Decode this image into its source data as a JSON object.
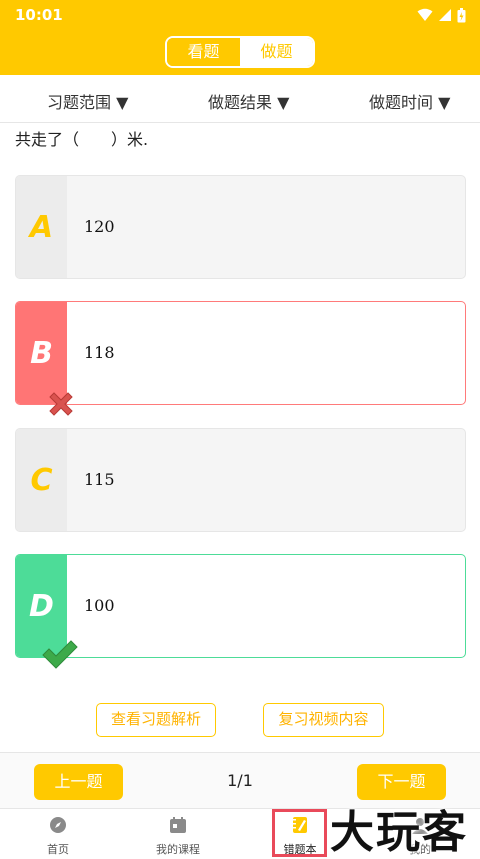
{
  "status": {
    "time": "10:01"
  },
  "header": {
    "tabs": [
      {
        "label": "看题",
        "active": false
      },
      {
        "label": "做题",
        "active": true
      }
    ]
  },
  "filters": [
    "习题范围",
    "做题结果",
    "做题时间"
  ],
  "question": {
    "text": "共走了（　　）米."
  },
  "options": [
    {
      "letter": "A",
      "value": "120",
      "state": "normal"
    },
    {
      "letter": "B",
      "value": "118",
      "state": "wrong"
    },
    {
      "letter": "C",
      "value": "115",
      "state": "normal"
    },
    {
      "letter": "D",
      "value": "100",
      "state": "correct"
    }
  ],
  "actions": {
    "analysis": "查看习题解析",
    "review_video": "复习视频内容"
  },
  "pager": {
    "prev": "上一题",
    "next": "下一题",
    "count": "1/1"
  },
  "nav": [
    {
      "label": "首页",
      "icon": "compass-icon"
    },
    {
      "label": "我的课程",
      "icon": "calendar-icon"
    },
    {
      "label": "错题本",
      "icon": "notebook-pen-icon",
      "active": true
    },
    {
      "label": "我的",
      "icon": "user-icon"
    }
  ],
  "watermark": "大玩客",
  "colors": {
    "accent": "#ffc900",
    "wrong": "#ff7575",
    "correct": "#4ddc98"
  }
}
